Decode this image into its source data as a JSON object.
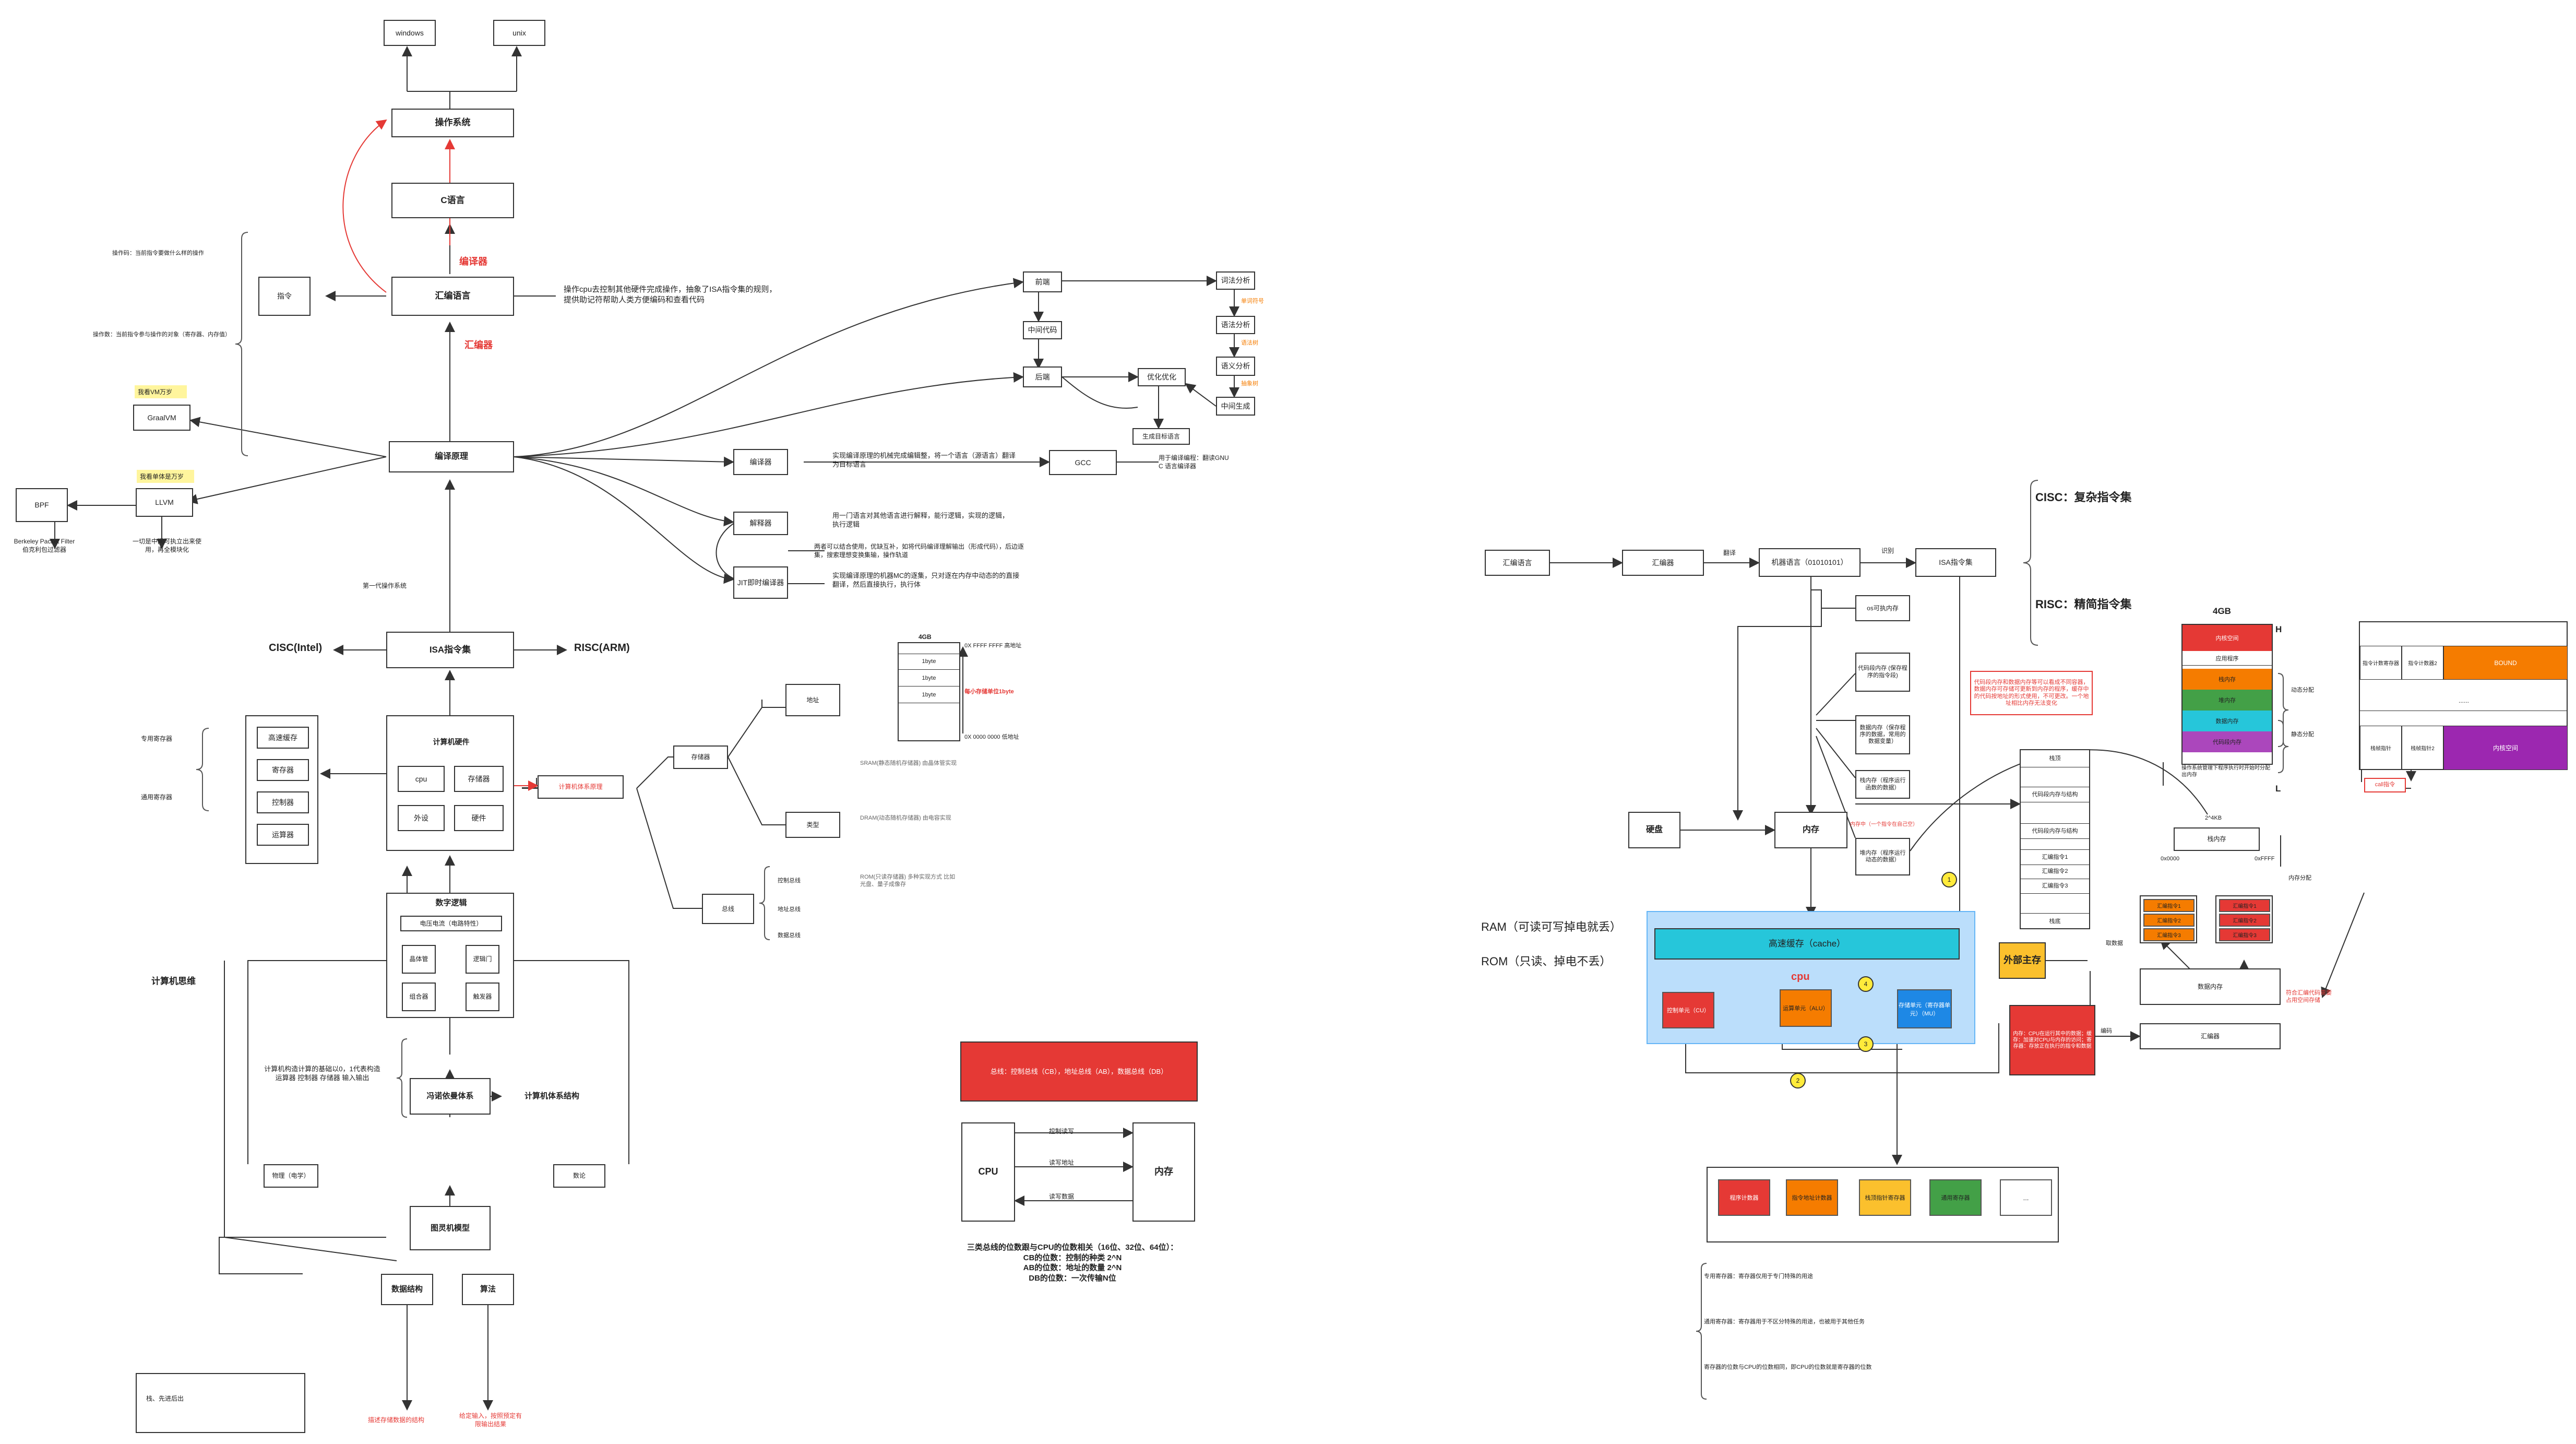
{
  "colors": {
    "red": "#e53935",
    "orange": "#f57c00",
    "yellow": "#fbc02d",
    "green": "#43a047",
    "cyan": "#26c6da",
    "purple": "#9c27b0",
    "lightblue": "#bbdefb",
    "gray": "#e0e0e0"
  },
  "left": {
    "windows": "windows",
    "unix": "unix",
    "os": "操作系统",
    "c_lang": "C语言",
    "compiler_label": "编译器",
    "asm": "汇编语言",
    "assembler_label": "汇编器",
    "instr": "指令",
    "opcode": "操作码：当前指令要做什么样的操作",
    "operand": "操作数：当前指令参与操作的对象（寄存器、内存值）",
    "asm_desc": "操作cpu去控制其他硬件完成操作，抽象了ISA指令集的规则，提供助记符帮助人类方便编码和查看代码",
    "compile_principle": "编译原理",
    "graalvm_note": "我看VM万岁",
    "graalvm": "GraalVM",
    "llvm_note": "我看单体是万岁",
    "llvm": "LLVM",
    "bpf": "BPF",
    "bpf_desc": "Berkeley Packet Filter 伯克利包过滤器",
    "llvm_desc": "一切是中间可执立出来使用，再全模块化",
    "first_os": "第一代操作系统",
    "isa": "ISA指令集",
    "cisc_intel": "CISC(Intel)",
    "risc_arm": "RISC(ARM)",
    "compiler_front": "前端",
    "ir": "中间代码",
    "backend": "后端",
    "lex": "词法分析",
    "syntax": "语法分析",
    "semantic": "语义分析",
    "ir_gen": "中间生成",
    "opt": "优化优化",
    "codegen": "生成目标语言",
    "token_flow": "单词符号",
    "tree_flow": "语法树",
    "ast": "抽象树",
    "compiler_box": "编译器",
    "compiler_desc": "实现编译原理的机械完成编辑整，将一个语言（源语言）翻译为目标语言",
    "gcc": "GCC",
    "gcc_desc": "用于编译编程：翻读GNU C 语言编译器",
    "interpreter": "解释器",
    "interpreter_desc": "用一门语言对其他语言进行解释，能行逻辑，实现的逻辑，执行逻辑",
    "interp_desc2": "两者可以结合使用，优缺互补，如将代码编译理解输出（形成代码），后边逐集，搜索理想变换集输，操作轨道",
    "jit": "JIT即时编译器",
    "jit_desc": "实现编译原理的机器MC的逐集，只对逐在内存中动态的的直接翻译，然后直接执行，执行体",
    "computer_hw": "计算机硬件",
    "cpu": "cpu",
    "storage": "存储器",
    "io_in": "外设",
    "io_dev": "硬件",
    "regs": [
      "高速缓存",
      "寄存器",
      "控制器",
      "运算器"
    ],
    "special_reg": "专用寄存器",
    "general_reg": "通用寄存器",
    "digital_logic": "数字逻辑",
    "circuit": "电压电流（电路特性）",
    "gates": [
      "晶体管",
      "逻辑门",
      "组合器",
      "触发器"
    ],
    "von_neumann": "冯诺依曼体系",
    "comp_arch": "计算机体系结构",
    "von_desc": "计算机构造计算的基础以0，1代表构造\n运算器  控制器  存储器  输入输出",
    "physics": "物理（电学）",
    "math": "数论",
    "turing": "图灵机模型",
    "comp_thinking": "计算机思维",
    "ds": "数据结构",
    "algo": "算法",
    "ds_note": "栈、先进后出",
    "ds_desc": "描述存储数据的结构",
    "algo_desc": "给定输入，按照预定有限输出结果",
    "mem_principle": "计算机体系原理",
    "storage2": "存储器",
    "address": "地址",
    "type": "类型",
    "bus": "总线",
    "mem_4gb": "4GB",
    "cells": [
      "",
      "1byte",
      "1byte",
      "1byte",
      ""
    ],
    "ffff": "0X FFFF FFFF 高地址",
    "cell_note": "每小存储单位1byte",
    "zero": "0X 0000 0000 低地址",
    "sram": "SRAM(静态随机存储器) 由晶体管实现",
    "dram": "DRAM(动态随机存储器) 由电容实现",
    "rom": "ROM(只读存储器) 多种实现方式 比如光盘、量子成像存",
    "bus_ctrl": "控制总线",
    "bus_addr": "地址总线",
    "bus_data": "数据总线",
    "bus_banner": "总线：控制总线（CB），地址总线（AB），数据总线（DB）",
    "cpu2": "CPU",
    "mem2": "内存",
    "rw_ctrl": "控制读写",
    "rw_addr": "读写地址",
    "rw_data": "读写数据",
    "bus_bits": "三类总线的位数跟与CPU的位数相关（16位、32位、64位）：\nCB的位数：控制的种类 2^N\nAB的位数：地址的数量 2^N\nDB的位数：一次传输N位"
  },
  "right": {
    "asm": "汇编语言",
    "assembler": "汇编器",
    "translate": "翻译",
    "machine": "机器语言（01010101）",
    "fetch": "识别",
    "isa": "ISA指令集",
    "cisc": "CISC：复杂指令集",
    "risc": "RISC：精简指令集",
    "vm": "os可执内存",
    "code_seg": "代码段内存\n(保存程序的指令段)",
    "data_seg": "数据内存（保存程序的数据，常用的数据变量）",
    "stack_seg": "栈内存（程序运行函数的数据）",
    "heap_seg": "堆内存（程序运行动态的数据）",
    "mem_note": "代码段内存和数据内存等可以看成不同容器，数据内存可存储可更新到内存的程序，缓存中的代码按地址的形式使用，不可更改。一个地址相比内存无法变化",
    "disk": "硬盘",
    "memory": "内存",
    "mem_red": "内存中（一个指令在自己空）",
    "stack_frames": [
      "栈顶",
      "代码段内存与结构",
      "",
      "代码段内存与结构",
      "汇编指令1",
      "汇编指令2",
      "汇编指令3",
      "",
      "栈底"
    ],
    "ram": "RAM（可读可写掉电就丢）",
    "rom": "ROM（只读、掉电不丢）",
    "cache": "高速缓存（cache）",
    "ext_store": "外部主存",
    "cpu": "cpu",
    "ctrl_unit": "控制单元（CU）",
    "alu": "运算单元（ALU）",
    "reg_unit": "存储单元（寄存器单元）（MU）",
    "n1": "1",
    "n2": "2",
    "n3": "3",
    "n4": "4",
    "reg_boxes": [
      "程序计数器",
      "指令地址计数器",
      "栈顶指针寄存器",
      "通用寄存器",
      "..."
    ],
    "red_note": "内存：CPU在运行其中的数据；缓存：加速对CPU与内存的访问；寄存器：存放正在执行的指令和数据",
    "bottom1": "专用寄存器：寄存器仅用于专门特殊的用途",
    "bottom2": "通用寄存器：寄存器用于不区分特殊的用途，也被用于其他任务",
    "bottom3": "寄存器的位数与CPU的位数相同，即CPU的位数就是寄存器的位数",
    "mem_4gb": "4GB",
    "high": "H",
    "low": "L",
    "mem_segs": [
      "内核空间",
      "应用程序",
      "栈内存",
      "堆内存",
      "数据内存",
      "代码段内存"
    ],
    "dyn": "动态分配",
    "static": "静态分配",
    "mem_desc": "操作系统管理下程序执行时开始时分配出内存",
    "kb": "2^4KB",
    "x0": "0x0000",
    "xf": "0xFFFF",
    "stack_mem": "栈内存",
    "orange_cells": [
      "汇编指令1",
      "汇编指令2",
      "汇编指令3"
    ],
    "red_cells": [
      "汇编指令1",
      "汇编指令2",
      "汇编指令3"
    ],
    "fetch2": "取数据",
    "data_mem": "数据内存",
    "assembler2": "汇编器",
    "compile2": "编码",
    "mem_alloc": "内存分配",
    "side_note": "符合汇编代码需要占用空间存储",
    "table_head": [
      "指令计数寄存器",
      "指令计数器2"
    ],
    "bound": "BOUND",
    "dots": "......",
    "frame": "栈帧指针",
    "frame2": "栈帧指针2",
    "call": "call指令"
  }
}
